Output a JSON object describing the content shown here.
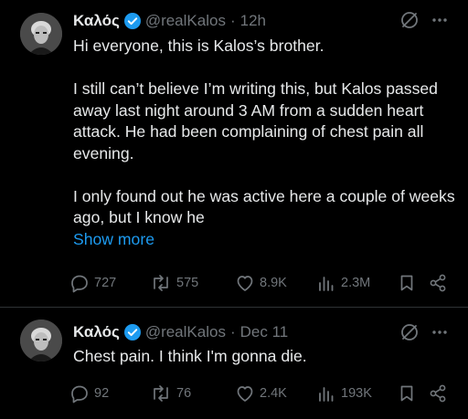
{
  "tweets": [
    {
      "author_name": "Καλός",
      "handle": "@realKalos",
      "separator": "·",
      "time": "12h",
      "paragraphs": [
        "Hi everyone, this is Kalos’s brother.",
        "I still can’t believe I’m writing this, but Kalos passed away last night around 3 AM from a sudden heart attack. He had been complaining of chest pain all evening.",
        "I only found out he was active here a couple of weeks ago, but I know he"
      ],
      "show_more": "Show more",
      "stats": {
        "replies": "727",
        "reposts": "575",
        "likes": "8.9K",
        "views": "2.3M"
      }
    },
    {
      "author_name": "Καλός",
      "handle": "@realKalos",
      "separator": "·",
      "time": "Dec 11",
      "text": "Chest pain. I think I'm gonna die.",
      "stats": {
        "replies": "92",
        "reposts": "76",
        "likes": "2.4K",
        "views": "193K"
      }
    }
  ],
  "colors": {
    "background": "#000000",
    "text": "#e7e9ea",
    "muted": "#71767b",
    "accent": "#1d9bf0",
    "divider": "#2f3336"
  },
  "icons": [
    "verified-badge-icon",
    "grok-icon",
    "more-icon",
    "reply-icon",
    "repost-icon",
    "like-icon",
    "views-icon",
    "bookmark-icon",
    "share-icon"
  ]
}
